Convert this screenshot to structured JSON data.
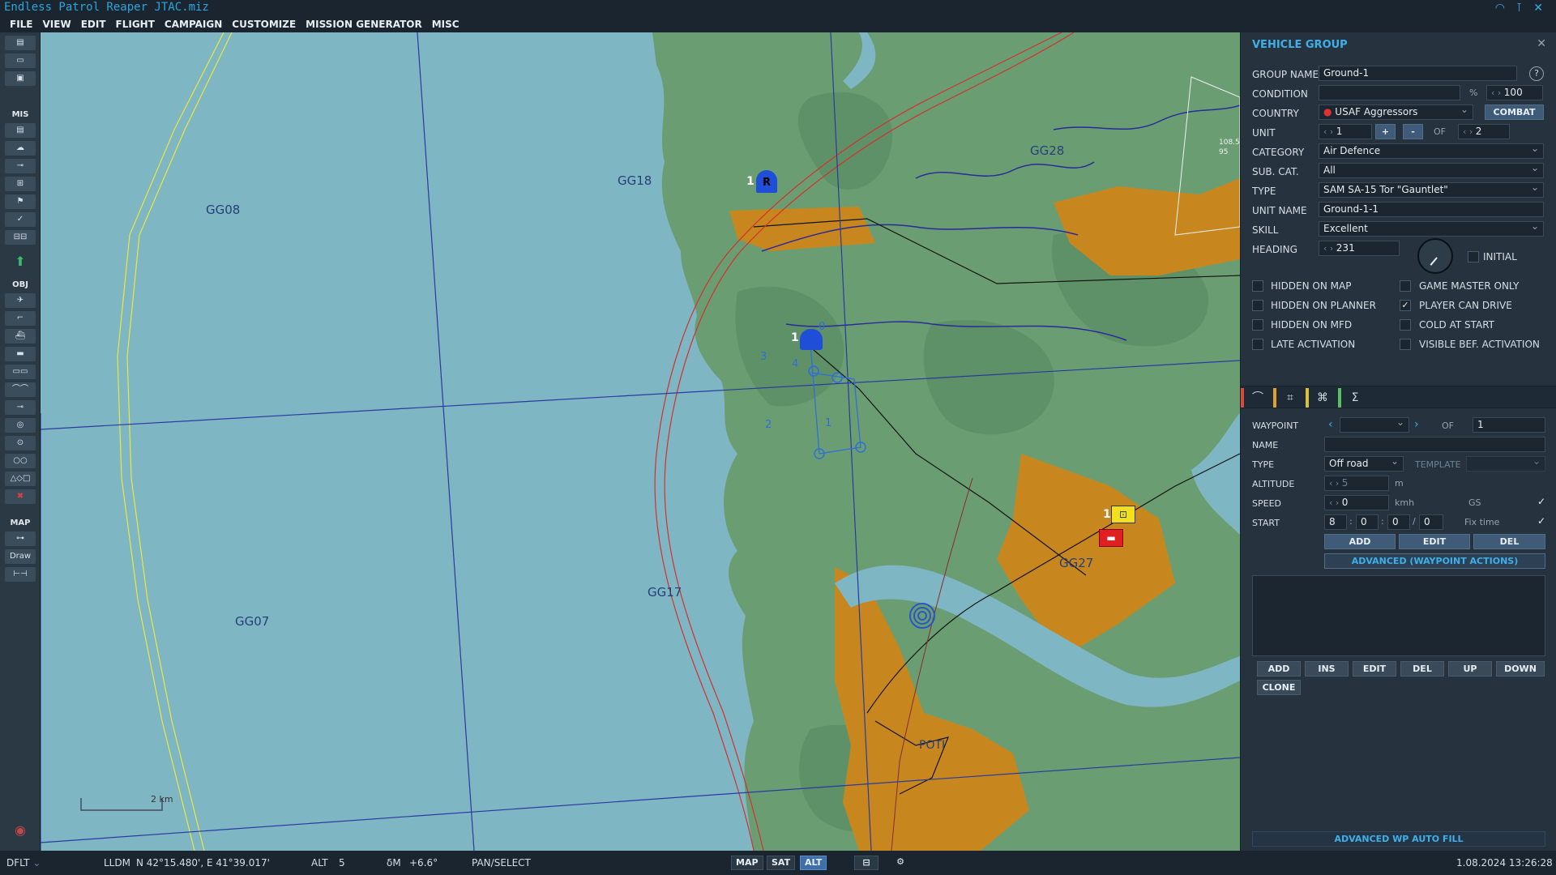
{
  "app": {
    "title": "Endless Patrol Reaper JTAC.miz",
    "menu": [
      "FILE",
      "VIEW",
      "EDIT",
      "FLIGHT",
      "CAMPAIGN",
      "CUSTOMIZE",
      "MISSION GENERATOR",
      "MISC"
    ]
  },
  "toolbar": {
    "sections": {
      "mis": "MIS",
      "obj": "OBJ",
      "map": "MAP"
    },
    "draw_label": "Draw"
  },
  "map": {
    "grid_labels": [
      "GG08",
      "GG18",
      "GG28",
      "GG07",
      "GG17",
      "GG27"
    ],
    "city_label": "POTI",
    "scale_label": "2 km",
    "units": {
      "awacs_letter": "R",
      "awacs_count": "1",
      "ship_count": "1",
      "ship_wp0": "0",
      "sam_count": "1"
    },
    "waypoint_numbers": [
      "1",
      "2",
      "3",
      "4"
    ],
    "radar_range_labels": [
      "108.5",
      "95"
    ]
  },
  "panel": {
    "title": "VEHICLE GROUP",
    "group_name_label": "GROUP NAME",
    "group_name": "Ground-1",
    "condition_label": "CONDITION",
    "condition_value": "100",
    "percent": "%",
    "country_label": "COUNTRY",
    "country": "USAF Aggressors",
    "combat_button": "COMBAT",
    "unit_label": "UNIT",
    "unit_value": "1",
    "plus": "+",
    "minus": "-",
    "of_label": "OF",
    "unit_total": "2",
    "category_label": "CATEGORY",
    "category": "Air Defence",
    "subcat_label": "SUB. CAT.",
    "subcat": "All",
    "type_label": "TYPE",
    "type": "SAM SA-15 Tor \"Gauntlet\"",
    "unit_name_label": "UNIT NAME",
    "unit_name": "Ground-1-1",
    "skill_label": "SKILL",
    "skill": "Excellent",
    "heading_label": "HEADING",
    "heading": "231",
    "initial_label": "INITIAL",
    "checkboxes": [
      {
        "label": "HIDDEN ON MAP",
        "checked": false
      },
      {
        "label": "GAME MASTER ONLY",
        "checked": false
      },
      {
        "label": "HIDDEN ON PLANNER",
        "checked": false
      },
      {
        "label": "PLAYER CAN DRIVE",
        "checked": true
      },
      {
        "label": "HIDDEN ON MFD",
        "checked": false
      },
      {
        "label": "COLD AT START",
        "checked": false
      },
      {
        "label": "LATE ACTIVATION",
        "checked": false
      },
      {
        "label": "VISIBLE BEF. ACTIVATION",
        "checked": false
      }
    ],
    "tab_colors": [
      "#d84a3a",
      "#e0a030",
      "#d8c040",
      "#58c060"
    ],
    "waypoint_label": "WAYPOINT",
    "waypoint_of": "OF",
    "waypoint_total": "1",
    "name_label": "NAME",
    "wp_type_label": "TYPE",
    "wp_type": "Off road",
    "template_label": "TEMPLATE",
    "altitude_label": "ALTITUDE",
    "altitude_value": "5",
    "altitude_unit": "m",
    "speed_label": "SPEED",
    "speed_value": "0",
    "speed_unit": "kmh",
    "gs_label": "GS",
    "start_label": "START",
    "start_day": "8",
    "start_h": "0",
    "start_m": "0",
    "start_s": "0",
    "fix_time_label": "Fix time",
    "wp_add": "ADD",
    "wp_edit": "EDIT",
    "wp_del": "DEL",
    "advanced_wp_actions": "ADVANCED (WAYPOINT ACTIONS)",
    "actions": [
      "ADD",
      "INS",
      "EDIT",
      "DEL",
      "UP",
      "DOWN"
    ],
    "clone": "CLONE",
    "auto_fill": "ADVANCED WP AUTO FILL"
  },
  "status": {
    "profile": "DFLT",
    "coord_mode": "LLDM",
    "coords": "N 42°15.480', E 41°39.017'",
    "alt_label": "ALT",
    "alt_value": "5",
    "mag_label": "δM",
    "mag_value": "+6.6°",
    "tool": "PAN/SELECT",
    "map_btn": "MAP",
    "sat_btn": "SAT",
    "alt_btn": "ALT",
    "datetime": "1.08.2024 13:26:28"
  }
}
